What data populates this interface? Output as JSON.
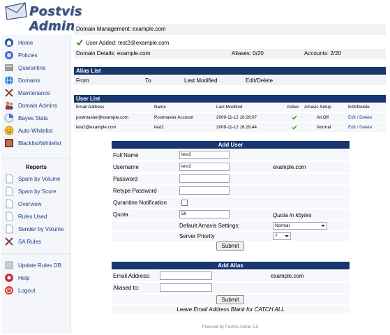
{
  "app": {
    "title": "Postvis Admin"
  },
  "sidebar": {
    "items": [
      {
        "label": "Home",
        "icon": "home-icon"
      },
      {
        "label": "Policies",
        "icon": "policies-icon"
      },
      {
        "label": "Quarantine",
        "icon": "quarantine-icon"
      },
      {
        "label": "Domains",
        "icon": "domains-icon"
      },
      {
        "label": "Maintenance",
        "icon": "maintenance-icon"
      },
      {
        "label": "Domain Admins",
        "icon": "domain-admins-icon"
      },
      {
        "label": "Bayes Stats",
        "icon": "bayes-stats-icon"
      },
      {
        "label": "Auto-Whitelist",
        "icon": "auto-whitelist-icon"
      },
      {
        "label": "Blacklist/Whitelist",
        "icon": "blacklist-whitelist-icon"
      }
    ],
    "reports_title": "Reports",
    "reports": [
      {
        "label": "Spam by Volume"
      },
      {
        "label": "Spam by Score"
      },
      {
        "label": "Overview"
      },
      {
        "label": "Rules Used"
      },
      {
        "label": "Sender by Volume"
      },
      {
        "label": "SA Rules"
      }
    ],
    "bottom": [
      {
        "label": "Update Rules DB"
      },
      {
        "label": "Help"
      },
      {
        "label": "Logout"
      }
    ]
  },
  "main": {
    "domain_management": "Domain Management: example.com",
    "status_message": "User Added: test2@example.com",
    "details": {
      "domain": "Domain Details: example.com",
      "aliases": "Aliases: 0/20",
      "accounts": "Accounts: 2/20"
    },
    "alias_list": {
      "title": "Alias List",
      "columns": [
        "From",
        "To",
        "Last Modified",
        "Edit/Delete"
      ]
    },
    "user_list": {
      "title": "User List",
      "columns": [
        "Email Address",
        "Name",
        "Last Modified",
        "Active",
        "Amavis Setup",
        "Edit/Delete"
      ],
      "rows": [
        {
          "email": "postmaster@example.com",
          "name": "Postmaster Account",
          "modified": "2009-11-12 16:29:07",
          "amavis": "All Off",
          "edit": "Edit / Delete"
        },
        {
          "email": "test2@example.com",
          "name": "test2",
          "modified": "2009-11-12 16:29:44",
          "amavis": "Normal",
          "edit": "Edit / Delete"
        }
      ]
    }
  },
  "add_user": {
    "title": "Add User",
    "full_name_label": "Full Name",
    "full_name_value": "test2",
    "username_label": "Username",
    "username_value": "test2",
    "username_domain": "example.com",
    "password_label": "Password",
    "retype_label": "Retype Password",
    "quarantine_label": "Qurantine Notification",
    "quota_label": "Quota",
    "quota_value": "50",
    "quota_note": "Quota in kbytes",
    "amavis_label": "Default Amavis Settings:",
    "amavis_value": "Normal",
    "priority_label": "Server Priority",
    "priority_value": "7",
    "submit": "Submit"
  },
  "add_alias": {
    "title": "Add Alias",
    "email_label": "Email Address:",
    "email_domain": "example.com",
    "aliased_label": "Aliased to:",
    "submit": "Submit",
    "note": "Leave Email Address Blank for CATCH ALL"
  },
  "footer": "Powered by Postvis Admin 1.6"
}
